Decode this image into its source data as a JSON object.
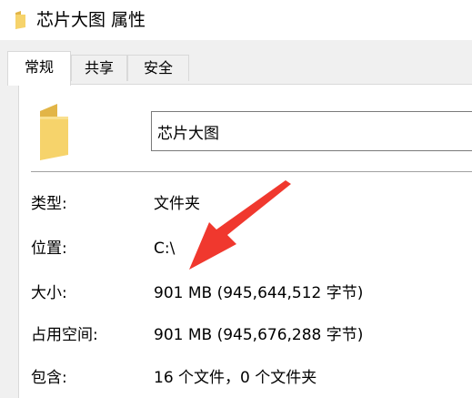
{
  "window": {
    "title": "芯片大图 属性",
    "icon": "folder-icon"
  },
  "tabs": [
    {
      "label": "常规",
      "active": true
    },
    {
      "label": "共享",
      "active": false
    },
    {
      "label": "安全",
      "active": false
    }
  ],
  "general": {
    "folder_icon": "folder-icon",
    "name_value": "芯片大图",
    "properties": [
      {
        "label": "类型:",
        "value": "文件夹"
      },
      {
        "label": "位置:",
        "value": "C:\\"
      },
      {
        "label": "大小:",
        "value": "901 MB (945,644,512 字节)"
      },
      {
        "label": "占用空间:",
        "value": "901 MB (945,676,288 字节)"
      },
      {
        "label": "包含:",
        "value": "16 个文件，0 个文件夹"
      }
    ]
  },
  "annotation": {
    "arrow_color": "#f0382e"
  },
  "colors": {
    "folder_yellow": "#f6d36b",
    "folder_shade": "#e2b547"
  }
}
